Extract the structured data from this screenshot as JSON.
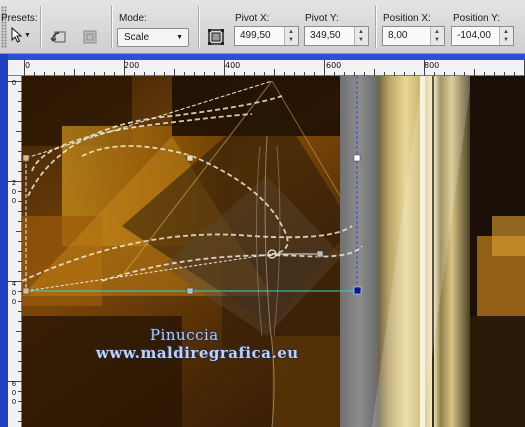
{
  "toolbar": {
    "presets_label": "Presets:",
    "mode_label": "Mode:",
    "mode_value": "Scale",
    "pivot_x_label": "Pivot X:",
    "pivot_x_value": "499,50",
    "pivot_y_label": "Pivot Y:",
    "pivot_y_value": "349,50",
    "position_x_label": "Position X:",
    "position_x_value": "8,00",
    "position_y_label": "Position Y:",
    "position_y_value": "-104,00"
  },
  "ruler": {
    "h_ticks": [
      "0",
      "200",
      "400",
      "600",
      "800"
    ],
    "v_ticks": [
      [
        "0"
      ],
      [
        "2",
        "0",
        "0"
      ],
      [
        "4",
        "0",
        "0"
      ],
      [
        "6",
        "0",
        "0"
      ]
    ]
  },
  "canvas": {
    "watermark_line1": "Pinuccia",
    "watermark_line2": "www.maldiregrafica.eu"
  },
  "colors": {
    "ruler_accent": "#2b4fd6",
    "toolbar_bg": "#d8d8d8",
    "selection_line": "#2b4fd6"
  }
}
